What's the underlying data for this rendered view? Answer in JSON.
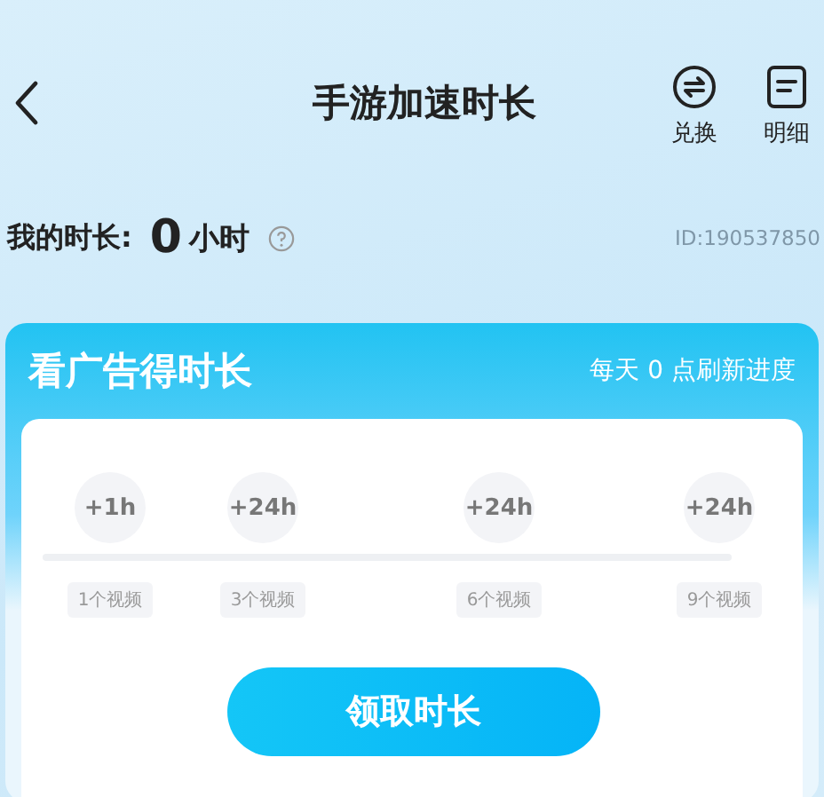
{
  "header": {
    "title": "手游加速时长",
    "actions": [
      {
        "label": "兑换",
        "kind": "exchange"
      },
      {
        "label": "明细",
        "kind": "detail"
      }
    ]
  },
  "balance": {
    "label": "我的时长:",
    "value": "0",
    "unit": "小时",
    "user_id": "ID:190537850"
  },
  "ad_card": {
    "title": "看广告得时长",
    "refresh_note": "每天 0 点刷新进度",
    "milestones": [
      {
        "reward": "+1h",
        "requirement": "1个视频"
      },
      {
        "reward": "+24h",
        "requirement": "3个视频"
      },
      {
        "reward": "+24h",
        "requirement": "6个视频"
      },
      {
        "reward": "+24h",
        "requirement": "9个视频"
      }
    ],
    "claim_button": "领取时长"
  }
}
